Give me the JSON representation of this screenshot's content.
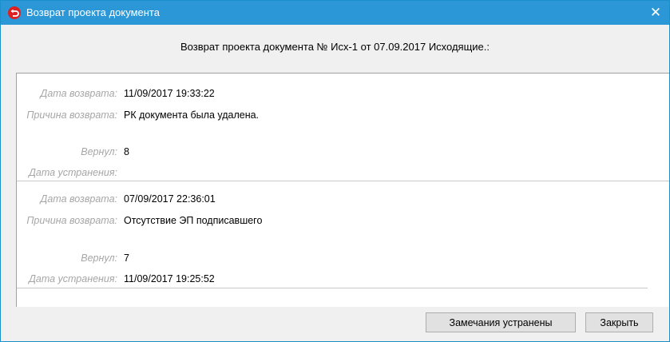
{
  "window": {
    "title": "Возврат проекта документа",
    "close_glyph": "✕",
    "accent_color": "#2b97d6",
    "icon": "return-arrow-icon"
  },
  "header": {
    "text": "Возврат проекта документа № Исх-1 от 07.09.2017 Исходящие.:"
  },
  "labels": {
    "return_date": "Дата возврата:",
    "reason": "Причина возврата:",
    "returned_by": "Вернул:",
    "fix_date": "Дата устранения:"
  },
  "records": [
    {
      "return_date": "11/09/2017 19:33:22",
      "reason": "РК документа была удалена.",
      "returned_by": "8",
      "fix_date": ""
    },
    {
      "return_date": "07/09/2017 22:36:01",
      "reason": "Отсутствие ЭП подписавшего",
      "returned_by": "7",
      "fix_date": "11/09/2017 19:25:52"
    }
  ],
  "buttons": {
    "fixed": "Замечания устранены",
    "close": "Закрыть"
  }
}
